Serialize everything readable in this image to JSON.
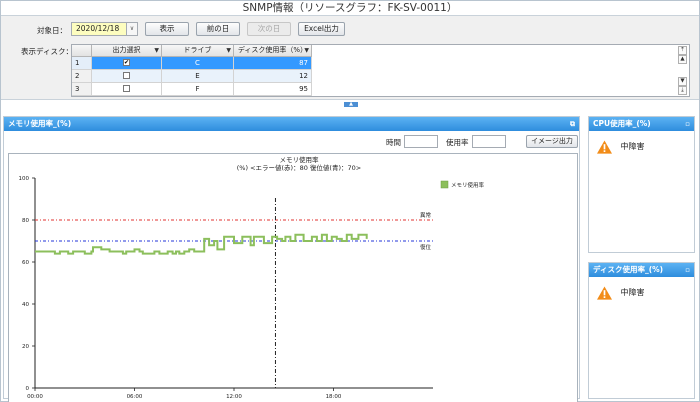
{
  "window": {
    "title": "SNMP情報（リソースグラフ：FK-SV-0011）"
  },
  "controls": {
    "date_label": "対象日：",
    "date_value": "2020/12/18",
    "show_button": "表示",
    "prev_button": "前の日",
    "next_button": "次の日",
    "excel_button": "Excel出力",
    "disk_label": "表示ディスク："
  },
  "disk_table": {
    "headers": [
      "出力選択",
      "ドライブ",
      "ディスク使用率（%）"
    ],
    "rows": [
      {
        "no": "1",
        "checked": true,
        "drive": "C",
        "usage": "87"
      },
      {
        "no": "2",
        "checked": false,
        "drive": "E",
        "usage": "12"
      },
      {
        "no": "3",
        "checked": false,
        "drive": "F",
        "usage": "95"
      }
    ]
  },
  "memory_panel": {
    "title": "メモリ使用率_(%)",
    "time_label": "時間",
    "usage_label": "使用率",
    "image_button": "イメージ出力"
  },
  "cpu_panel": {
    "title": "CPU使用率_(%)",
    "status": "中障害"
  },
  "disk_panel": {
    "title": "ディスク使用率_(%)",
    "status": "中障害"
  },
  "colors": {
    "header_blue": "#3a95e0",
    "series_green": "#8cbf5c",
    "error_red": "#e0312f",
    "recover_blue": "#2336d8",
    "warning_orange": "#f28c18",
    "selection_blue": "#3399ff"
  },
  "chart_data": {
    "type": "line",
    "title": "メモリ使用率",
    "subtitle": "(%) <エラー値(赤)：80 復位値(青)：70>",
    "ylim": [
      0,
      100
    ],
    "yticks": [
      "0",
      "20",
      "40",
      "60",
      "80",
      "100"
    ],
    "xticks": [
      "00:00",
      "06:00",
      "12:00",
      "18:00"
    ],
    "xlim_hours": [
      0,
      24
    ],
    "error_threshold": 80,
    "error_label": "異常",
    "recover_threshold": 70,
    "recover_label": "復位",
    "current_time_hours": 14.5,
    "series": [
      {
        "name": "メモリ使用率",
        "points": [
          [
            0,
            65
          ],
          [
            1,
            65
          ],
          [
            1.2,
            64
          ],
          [
            1.5,
            65
          ],
          [
            2,
            64
          ],
          [
            2.3,
            65
          ],
          [
            3,
            64
          ],
          [
            3.4,
            65
          ],
          [
            3.5,
            67
          ],
          [
            4,
            66
          ],
          [
            4.5,
            65
          ],
          [
            5,
            65
          ],
          [
            5.3,
            64
          ],
          [
            5.5,
            65
          ],
          [
            6,
            66
          ],
          [
            6.3,
            65
          ],
          [
            6.5,
            64
          ],
          [
            7,
            64
          ],
          [
            7.2,
            65
          ],
          [
            7.5,
            64
          ],
          [
            8,
            65
          ],
          [
            8.3,
            64
          ],
          [
            8.5,
            65
          ],
          [
            8.7,
            64
          ],
          [
            9,
            65
          ],
          [
            9.3,
            66
          ],
          [
            9.6,
            65
          ],
          [
            10,
            65
          ],
          [
            10.2,
            71
          ],
          [
            10.5,
            68
          ],
          [
            10.8,
            70
          ],
          [
            11,
            66
          ],
          [
            11.2,
            66
          ],
          [
            11.4,
            72
          ],
          [
            11.8,
            72
          ],
          [
            12,
            69
          ],
          [
            12.3,
            69
          ],
          [
            12.5,
            72
          ],
          [
            12.9,
            72
          ],
          [
            13,
            68
          ],
          [
            13.2,
            72
          ],
          [
            13.6,
            72
          ],
          [
            13.8,
            69
          ],
          [
            14.1,
            69
          ],
          [
            14.3,
            72
          ],
          [
            14.6,
            71
          ],
          [
            14.9,
            70
          ],
          [
            15.1,
            72
          ],
          [
            15.4,
            70
          ],
          [
            15.7,
            73
          ],
          [
            16,
            73
          ],
          [
            16.2,
            70
          ],
          [
            16.5,
            70
          ],
          [
            16.7,
            72
          ],
          [
            17,
            70
          ],
          [
            17.3,
            73
          ],
          [
            17.6,
            70
          ],
          [
            17.9,
            72
          ],
          [
            18.2,
            71
          ],
          [
            18.5,
            70
          ],
          [
            18.8,
            73
          ],
          [
            19.1,
            71
          ],
          [
            19.3,
            71
          ],
          [
            19.5,
            73
          ],
          [
            19.8,
            73
          ],
          [
            20,
            71
          ]
        ]
      }
    ],
    "legend_position": "top-right",
    "grid": false
  }
}
